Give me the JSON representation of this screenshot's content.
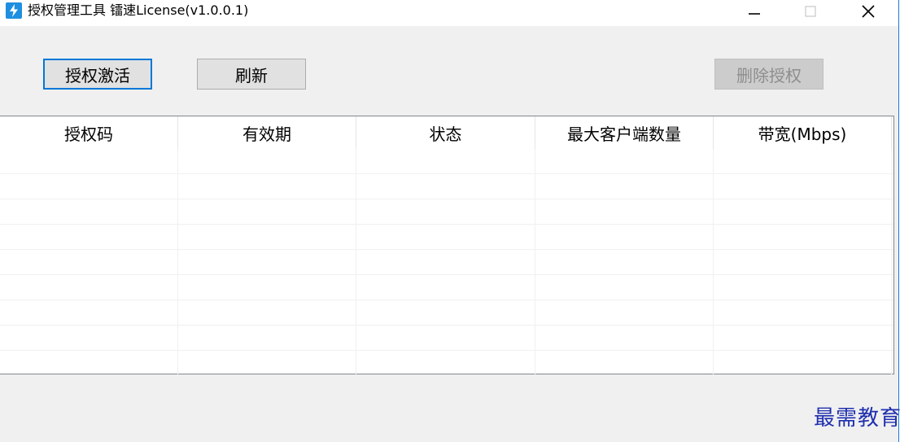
{
  "window": {
    "title": "授权管理工具 镭速License(v1.0.0.1)",
    "accent": "#0078d7"
  },
  "toolbar": {
    "activate_label": "授权激活",
    "refresh_label": "刷新",
    "delete_label": "删除授权"
  },
  "table": {
    "columns": [
      "授权码",
      "有效期",
      "状态",
      "最大客户端数量",
      "带宽(Mbps)"
    ],
    "rows": []
  },
  "watermark": "最需教育",
  "icons": {
    "app": "lightning-bolt-icon",
    "minimize": "minimize-icon",
    "maximize": "maximize-icon",
    "close": "close-icon"
  }
}
